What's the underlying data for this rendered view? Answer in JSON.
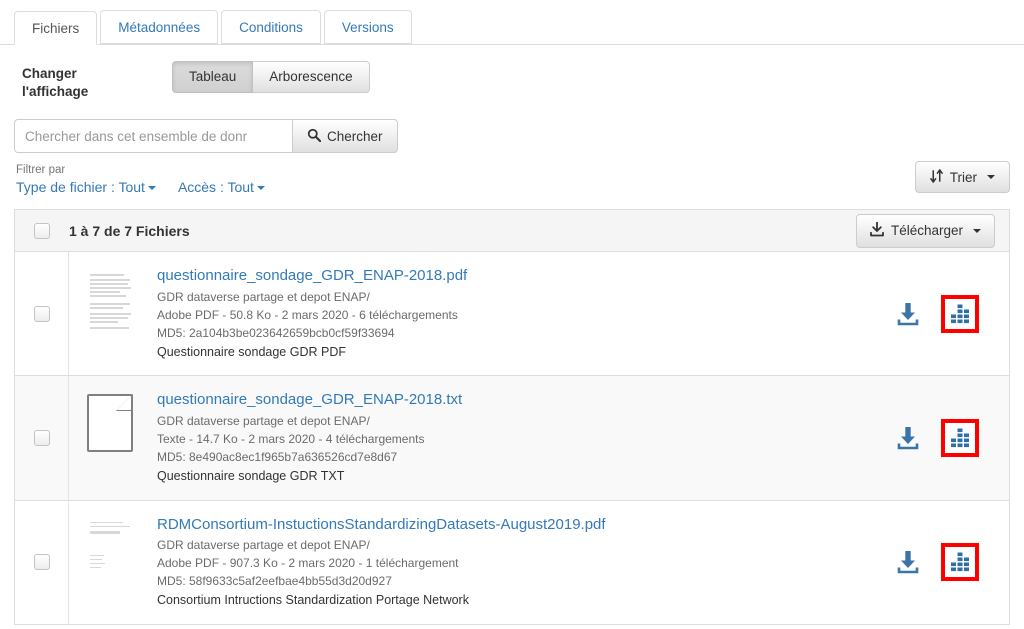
{
  "tabs": [
    {
      "label": "Fichiers",
      "active": true
    },
    {
      "label": "Métadonnées",
      "active": false
    },
    {
      "label": "Conditions",
      "active": false
    },
    {
      "label": "Versions",
      "active": false
    }
  ],
  "display": {
    "label": "Changer l'affichage",
    "label_line1": "Changer",
    "label_line2": "l'affichage",
    "options": [
      {
        "label": "Tableau",
        "pressed": true
      },
      {
        "label": "Arborescence",
        "pressed": false
      }
    ]
  },
  "search": {
    "placeholder": "Chercher dans cet ensemble de donr",
    "value": "",
    "button_label": "Chercher",
    "button_icon": "search-icon"
  },
  "filters": {
    "title": "Filtrer par",
    "items": [
      {
        "label": "Type de fichier : Tout",
        "icon": "chevron-down-icon"
      },
      {
        "label": "Accès : Tout",
        "icon": "chevron-down-icon"
      }
    ],
    "sort_button": {
      "label": "Trier",
      "icon": "sort-icon",
      "caret": "chevron-down-icon"
    }
  },
  "table": {
    "count_label": "1 à 7 de 7 Fichiers",
    "select_all_checkbox": false,
    "download_button": {
      "label": "Télécharger",
      "icon": "download-icon",
      "caret": "chevron-down-icon"
    },
    "rows": [
      {
        "name": "questionnaire_sondage_GDR_ENAP-2018.pdf",
        "path": "GDR dataverse partage et depot ENAP/",
        "meta": "Adobe PDF - 50.8 Ko - 2 mars 2020 - 6 téléchargements",
        "md5": "MD5: 2a104b3be023642659bcb0cf59f33694",
        "description": "Questionnaire sondage GDR PDF",
        "thumbnail": "pdf-preview-thumbnail",
        "alt": false,
        "actions": [
          {
            "icon": "download-icon",
            "highlighted": false
          },
          {
            "icon": "explore-data-icon",
            "highlighted": true
          }
        ]
      },
      {
        "name": "questionnaire_sondage_GDR_ENAP-2018.txt",
        "path": "GDR dataverse partage et depot ENAP/",
        "meta": "Texte - 14.7 Ko - 2 mars 2020 - 4 téléchargements",
        "md5": "MD5: 8e490ac8ec1f965b7a636526cd7e8d67",
        "description": "Questionnaire sondage GDR TXT",
        "thumbnail": "generic-document-icon",
        "alt": true,
        "actions": [
          {
            "icon": "download-icon",
            "highlighted": false
          },
          {
            "icon": "explore-data-icon",
            "highlighted": true
          }
        ]
      },
      {
        "name": "RDMConsortium-InstuctionsStandardizingDatasets-August2019.pdf",
        "path": "GDR dataverse partage et depot ENAP/",
        "meta": "Adobe PDF - 907.3 Ko - 2 mars 2020 - 1 téléchargement",
        "md5": "MD5: 58f9633c5af2eefbae4bb55d3d20d927",
        "description": "Consortium Intructions Standardization Portage Network",
        "thumbnail": "pdf-preview-thumbnail",
        "alt": false,
        "actions": [
          {
            "icon": "download-icon",
            "highlighted": false
          },
          {
            "icon": "explore-data-icon",
            "highlighted": true
          }
        ]
      }
    ]
  },
  "colors": {
    "link": "#337ab7",
    "icon_blue": "#3a74a8",
    "highlight": "#ff0000",
    "border": "#dddddd",
    "row_alt": "#f9f9f9",
    "head_bg": "#f5f5f5"
  }
}
